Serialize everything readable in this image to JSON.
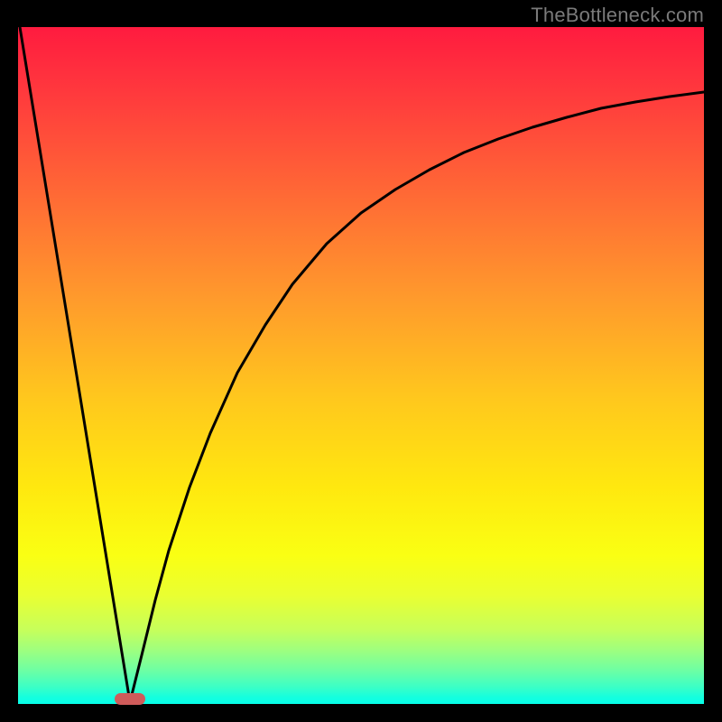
{
  "watermark": "TheBottleneck.com",
  "chart_data": {
    "type": "line",
    "title": "",
    "xlabel": "",
    "ylabel": "",
    "xlim": [
      0,
      100
    ],
    "ylim": [
      0,
      100
    ],
    "grid": false,
    "series": [
      {
        "name": "left-line",
        "x": [
          0,
          16.3
        ],
        "values": [
          100,
          0
        ]
      },
      {
        "name": "right-curve",
        "x": [
          16.3,
          18,
          20,
          22,
          25,
          28,
          32,
          36,
          40,
          45,
          50,
          55,
          60,
          65,
          70,
          75,
          80,
          85,
          90,
          95,
          100
        ],
        "values": [
          0,
          7,
          15,
          22.5,
          32,
          40,
          49,
          56,
          62,
          68,
          72.5,
          76,
          79,
          81.5,
          83.5,
          85.2,
          86.7,
          88,
          89,
          89.8,
          90.4
        ]
      }
    ],
    "marker": {
      "x": 16.3,
      "y": 0,
      "color": "#cf5b5a"
    },
    "gradient_stops": [
      {
        "pos": 0,
        "color": "#ff1b3f"
      },
      {
        "pos": 25,
        "color": "#ff6a35"
      },
      {
        "pos": 55,
        "color": "#ffc81d"
      },
      {
        "pos": 78,
        "color": "#faff13"
      },
      {
        "pos": 95,
        "color": "#6effa3"
      },
      {
        "pos": 100,
        "color": "#06ffe9"
      }
    ]
  }
}
